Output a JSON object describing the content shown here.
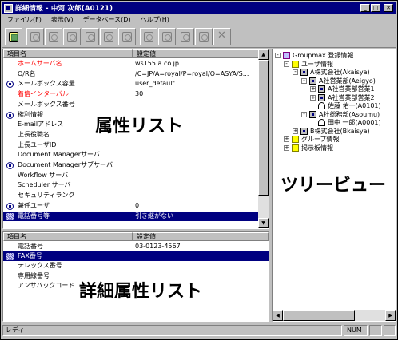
{
  "window": {
    "title": "詳細情報 - 中河  次郎(A0121)",
    "min_label": "_",
    "max_label": "□",
    "close_label": "✕"
  },
  "menu": {
    "items": [
      "ファイル(F)",
      "表示(V)",
      "データベース(D)",
      "ヘルプ(H)"
    ]
  },
  "toolbar": {
    "icons": [
      "new-entry-icon",
      "org-icon",
      "org-add-icon",
      "user-add-icon",
      "group-add-icon",
      "mailbox-icon",
      "bulletin-icon",
      "move-icon",
      "move-user-icon",
      "delete-link-icon",
      "lock-icon",
      "delete-icon"
    ]
  },
  "attributes": {
    "header_item": "項目名",
    "header_value": "設定値",
    "rows": [
      {
        "label": "ホームサーバ名",
        "value": "ws155.a.co.jp",
        "red": true,
        "icon": ""
      },
      {
        "label": "O/R名",
        "value": "/C=JP/A=royal/P=royal/O=ASYA/S...",
        "red": false,
        "icon": ""
      },
      {
        "label": "メールボックス容量",
        "value": "user_default",
        "red": false,
        "icon": "round"
      },
      {
        "label": "着信インターバル",
        "value": "30",
        "red": true,
        "icon": ""
      },
      {
        "label": "メールボックス番号",
        "value": "",
        "red": false,
        "icon": ""
      },
      {
        "label": "権利情報",
        "value": "",
        "red": false,
        "icon": "round"
      },
      {
        "label": "E-mailアドレス",
        "value": "",
        "red": false,
        "icon": ""
      },
      {
        "label": "上長役職名",
        "value": "",
        "red": false,
        "icon": ""
      },
      {
        "label": "上長ユーザID",
        "value": "",
        "red": false,
        "icon": ""
      },
      {
        "label": "Document Managerサーバ",
        "value": "",
        "red": false,
        "icon": ""
      },
      {
        "label": "Document Managerサブサーバ",
        "value": "",
        "red": false,
        "icon": "round"
      },
      {
        "label": "Workflow サーバ",
        "value": "",
        "red": false,
        "icon": ""
      },
      {
        "label": "Scheduler サーバ",
        "value": "",
        "red": false,
        "icon": ""
      },
      {
        "label": "セキュリティランク",
        "value": "",
        "red": false,
        "icon": ""
      },
      {
        "label": "兼任ユーザ",
        "value": "0",
        "red": false,
        "icon": "round"
      },
      {
        "label": "電話番号等",
        "value": "引き継がない",
        "red": false,
        "icon": "pattern",
        "selected": true
      }
    ],
    "overlay_label": "属性リスト"
  },
  "details": {
    "header_item": "項目名",
    "header_value": "設定値",
    "rows": [
      {
        "label": "電話番号",
        "value": "03-0123-4567",
        "selected": false
      },
      {
        "label": "FAX番号",
        "value": "",
        "selected": true
      },
      {
        "label": "テレックス番号",
        "value": "",
        "selected": false
      },
      {
        "label": "専用線番号",
        "value": "",
        "selected": false
      },
      {
        "label": "アンサバックコード",
        "value": "",
        "selected": false
      }
    ],
    "overlay_label": "詳細属性リスト"
  },
  "tree": {
    "overlay_label": "ツリービュー",
    "nodes": [
      {
        "label": "Groupmax 登録情報",
        "level": 0,
        "expander": "-",
        "icon": "root"
      },
      {
        "label": "ユーザ情報",
        "level": 1,
        "expander": "-",
        "icon": "folder"
      },
      {
        "label": "A株式会社(Akaisya)",
        "level": 2,
        "expander": "-",
        "icon": "org"
      },
      {
        "label": "A社営業部(Aeigyo)",
        "level": 3,
        "expander": "-",
        "icon": "org"
      },
      {
        "label": "A社営業部営業1",
        "level": 4,
        "expander": "+",
        "icon": "org"
      },
      {
        "label": "A社営業部営業2",
        "level": 4,
        "expander": "+",
        "icon": "org"
      },
      {
        "label": "佐藤  佑一(A0101)",
        "level": 4,
        "expander": "",
        "icon": "user"
      },
      {
        "label": "A社総務部(Asoumu)",
        "level": 3,
        "expander": "-",
        "icon": "org"
      },
      {
        "label": "田中  一郎(A0001)",
        "level": 4,
        "expander": "",
        "icon": "user"
      },
      {
        "label": "B株式会社(Bkaisya)",
        "level": 2,
        "expander": "+",
        "icon": "org"
      },
      {
        "label": "グループ情報",
        "level": 1,
        "expander": "+",
        "icon": "folder"
      },
      {
        "label": "掲示板情報",
        "level": 1,
        "expander": "+",
        "icon": "folder"
      }
    ]
  },
  "status": {
    "text": "レディ",
    "num": "NUM"
  },
  "scroll": {
    "up": "▲",
    "down": "▼",
    "left": "◀",
    "right": "▶"
  }
}
